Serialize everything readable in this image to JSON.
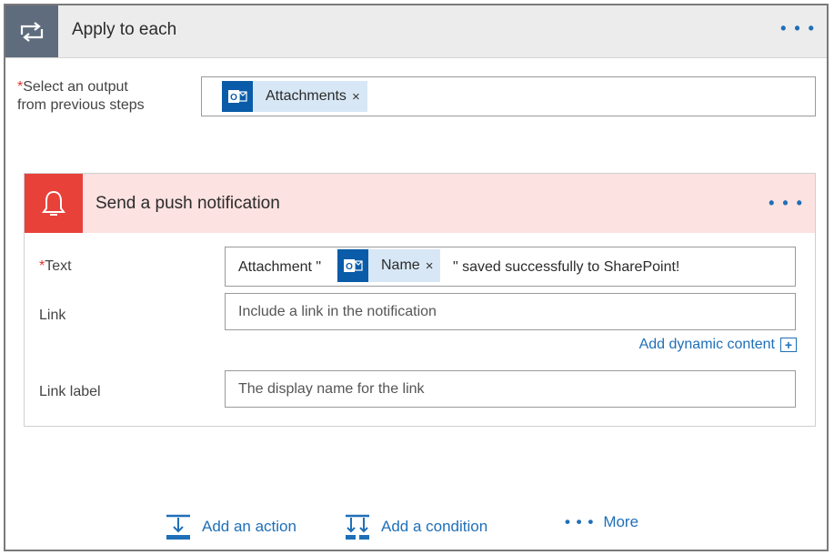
{
  "loop": {
    "title": "Apply to each",
    "more_label": "• • •",
    "select_label_line1": "Select an output",
    "select_label_line2": "from previous steps",
    "required_mark": "*",
    "token": {
      "icon": "outlook-icon",
      "label": "Attachments",
      "remove": "×"
    }
  },
  "card": {
    "title": "Send a push notification",
    "more_label": "• • •",
    "icon": "bell-icon",
    "fields": {
      "text": {
        "label": "Text",
        "required_mark": "*",
        "prefix": "Attachment \"",
        "token": {
          "icon": "outlook-icon",
          "label": "Name",
          "remove": "×"
        },
        "suffix": "\" saved successfully to SharePoint!"
      },
      "link": {
        "label": "Link",
        "placeholder": "Include a link in the notification"
      },
      "link_label": {
        "label": "Link label",
        "placeholder": "The display name for the link"
      }
    },
    "add_dynamic": "Add dynamic content",
    "add_dynamic_icon": "+"
  },
  "actions": {
    "add_action": "Add an action",
    "add_condition": "Add a condition",
    "more": "More",
    "more_dots": "• • •"
  },
  "colors": {
    "accent": "#1f6fb8",
    "loop_icon_bg": "#5f6c7d",
    "notification_red": "#e8413a",
    "notification_header": "#fce2e1",
    "token_bg": "#d7e7f5",
    "outlook_blue": "#0a5ca8"
  }
}
